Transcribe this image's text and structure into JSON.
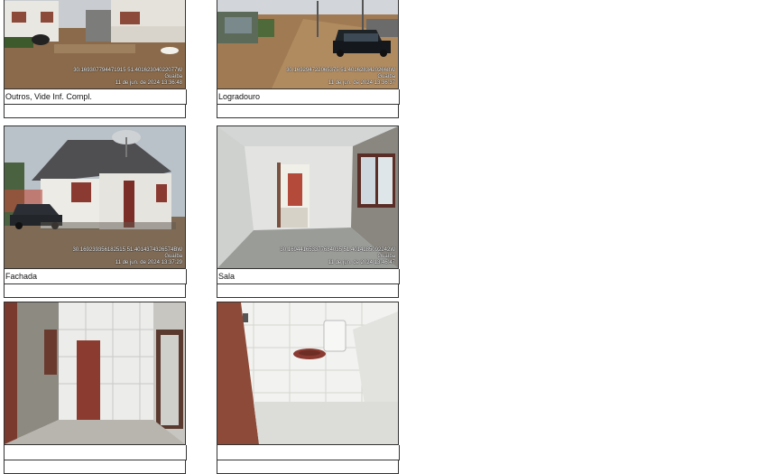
{
  "photos": [
    {
      "caption": "Outros, Vide Inf. Compl.",
      "stamp": {
        "coords": "30.169307794471915 51.40162304022077W",
        "city": "Guaíba",
        "date": "11 de jun. de 2024 13:36:48"
      },
      "scene": "street-houses-dog"
    },
    {
      "caption": "Logradouro",
      "stamp": {
        "coords": "30.169294722065375 51.40162834202668W",
        "city": "Guaíba",
        "date": "11 de jun. de 2024 13:36:37"
      },
      "scene": "dirt-road-car"
    },
    {
      "caption": "Fachada",
      "stamp": {
        "coords": "30.169239356182515 51.4014374326574BW",
        "city": "Guaíba",
        "date": "11 de jun. de 2024 13:37:29"
      },
      "scene": "house-front-car"
    },
    {
      "caption": "Sala",
      "stamp": {
        "coords": "30.169441653377684035 51.4014185092242W",
        "city": "Guaíba",
        "date": "11 de jun. de 2024 13:46:47"
      },
      "scene": "room-interior"
    },
    {
      "caption": "",
      "stamp": null,
      "scene": "hallway-tiles"
    },
    {
      "caption": "",
      "stamp": null,
      "scene": "bathroom-toilet"
    }
  ]
}
